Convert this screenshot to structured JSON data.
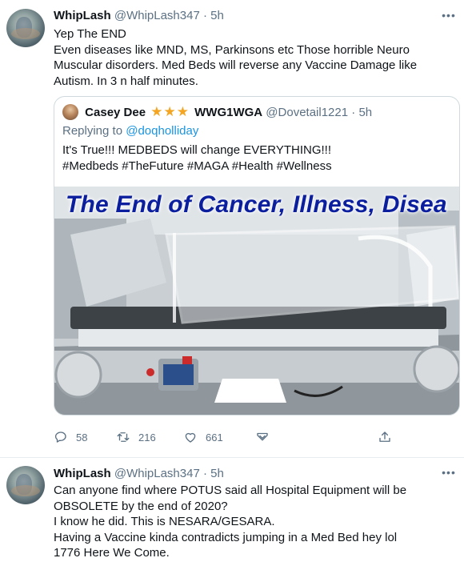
{
  "tweets": [
    {
      "name": "WhipLash",
      "handle": "@WhipLash347",
      "dot": "·",
      "time": "5h",
      "lines": [
        "Yep The END",
        "Even diseases like MND, MS, Parkinsons etc Those horrible Neuro Muscular disorders. Med Beds will reverse any Vaccine Damage like Autism. In 3 n half minutes."
      ],
      "quote": {
        "name": "Casey Dee",
        "stars": "★★★",
        "name_suffix": "WWG1WGA",
        "handle": "@Dovetail1221",
        "dot": "·",
        "time": "5h",
        "replying_to_label": "Replying to",
        "replying_to_handle": "@doqholliday",
        "lines": [
          "It's True!!! MEDBEDS will change EVERYTHING!!!",
          "#Medbeds #TheFuture #MAGA #Health #Wellness"
        ],
        "image_caption": "The End of Cancer, Illness, Disea"
      },
      "actions": {
        "replies": "58",
        "retweets": "216",
        "likes": "661"
      }
    },
    {
      "name": "WhipLash",
      "handle": "@WhipLash347",
      "dot": "·",
      "time": "5h",
      "lines": [
        "Can anyone find where POTUS said all Hospital Equipment will be OBSOLETE by the end of 2020?",
        "I know he did. This is NESARA/GESARA.",
        "Having a Vaccine kinda contradicts jumping in a Med Bed hey lol",
        "1776 Here We Come."
      ]
    }
  ],
  "icons": {
    "more": "more-options-icon",
    "reply": "reply-icon",
    "retweet": "retweet-icon",
    "like": "heart-icon",
    "dm": "direct-message-icon",
    "share": "share-icon"
  },
  "colors": {
    "text": "#0f1419",
    "secondary": "#5b7083",
    "link": "#1b95e0",
    "star": "#f4a623",
    "caption": "#0b1e9e",
    "border": "#cfd9de"
  }
}
